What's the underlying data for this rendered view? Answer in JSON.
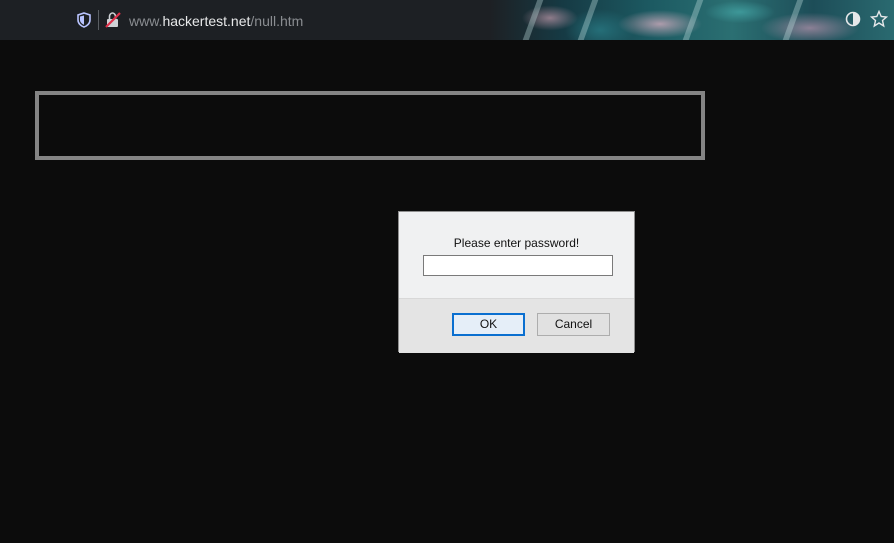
{
  "browser": {
    "url_prefix": "www.",
    "url_host": "hackertest.net",
    "url_path": "/null.htm",
    "icons": [
      "shield-icon",
      "tracking-blocked-icon",
      "extension-icon",
      "bookmark-star-icon"
    ]
  },
  "dialog": {
    "message": "Please enter password!",
    "input_value": "",
    "ok_label": "OK",
    "cancel_label": "Cancel"
  },
  "colors": {
    "page_background": "#0c0c0c",
    "frame_border": "#858585",
    "ok_focus": "#0a6fd0"
  }
}
